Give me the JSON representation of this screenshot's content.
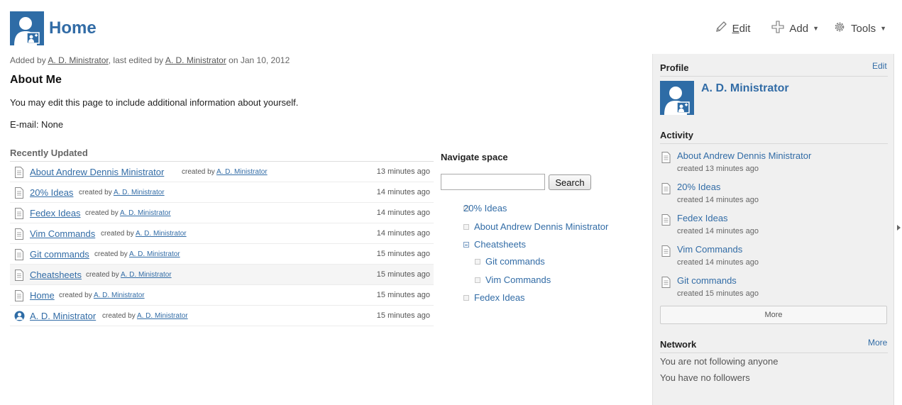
{
  "header": {
    "title": "Home",
    "toolbar": {
      "edit_label": "Edit",
      "add_label": "Add",
      "tools_label": "Tools"
    }
  },
  "byline": {
    "added_prefix": "Added by ",
    "added_user": "A. D. Ministrator",
    "edited_prefix": ", last edited by ",
    "edited_user": "A. D. Ministrator",
    "date_text": " on Jan 10, 2012"
  },
  "about": {
    "title": "About Me",
    "text": "You may edit this page to include additional information about yourself.",
    "email": "E-mail: None"
  },
  "recently_updated": {
    "title": "Recently Updated",
    "items": [
      {
        "title": "About Andrew Dennis Ministrator",
        "created_by_label": "created by",
        "user": "A. D. Ministrator",
        "time": "13 minutes ago",
        "icon": "page-icon"
      },
      {
        "title": "20% Ideas",
        "created_by_label": "created by",
        "user": "A. D. Ministrator",
        "time": "14 minutes ago",
        "icon": "page-icon"
      },
      {
        "title": "Fedex Ideas",
        "created_by_label": "created by",
        "user": "A. D. Ministrator",
        "time": "14 minutes ago",
        "icon": "page-icon"
      },
      {
        "title": "Vim Commands",
        "created_by_label": "created by",
        "user": "A. D. Ministrator",
        "time": "14 minutes ago",
        "icon": "page-icon"
      },
      {
        "title": "Git commands",
        "created_by_label": "created by",
        "user": "A. D. Ministrator",
        "time": "15 minutes ago",
        "icon": "page-icon"
      },
      {
        "title": "Cheatsheets",
        "created_by_label": "created by",
        "user": "A. D. Ministrator",
        "time": "15 minutes ago",
        "icon": "page-icon"
      },
      {
        "title": "Home",
        "created_by_label": "created by",
        "user": "A. D. Ministrator",
        "time": "15 minutes ago",
        "icon": "page-icon"
      },
      {
        "title": "A. D. Ministrator",
        "created_by_label": "created by",
        "user": "A. D. Ministrator",
        "time": "15 minutes ago",
        "icon": "user-profile-icon"
      }
    ]
  },
  "navigate": {
    "title": "Navigate space",
    "search_value": "",
    "search_button": "Search",
    "tree": [
      {
        "label": "20% Ideas"
      },
      {
        "label": "About Andrew Dennis Ministrator"
      },
      {
        "label": "Cheatsheets",
        "expanded": true
      },
      {
        "label": "Git commands"
      },
      {
        "label": "Vim Commands"
      },
      {
        "label": "Fedex Ideas"
      }
    ]
  },
  "sidebar": {
    "profile_title": "Profile",
    "profile_edit": "Edit",
    "profile_name": "A. D. Ministrator",
    "activity_title": "Activity",
    "activity": [
      {
        "title": "About Andrew Dennis Ministrator",
        "meta": "created 13 minutes ago"
      },
      {
        "title": "20% Ideas",
        "meta": "created 14 minutes ago"
      },
      {
        "title": "Fedex Ideas",
        "meta": "created 14 minutes ago"
      },
      {
        "title": "Vim Commands",
        "meta": "created 14 minutes ago"
      },
      {
        "title": "Git commands",
        "meta": "created 15 minutes ago"
      }
    ],
    "more_button": "More",
    "network_title": "Network",
    "network_more": "More",
    "following_text": "You are not following anyone",
    "followers_text": "You have no followers"
  },
  "colors": {
    "link": "#326ca6",
    "sidebar_bg": "#f0f0f0",
    "avatar_bg": "#2e6ca6"
  }
}
